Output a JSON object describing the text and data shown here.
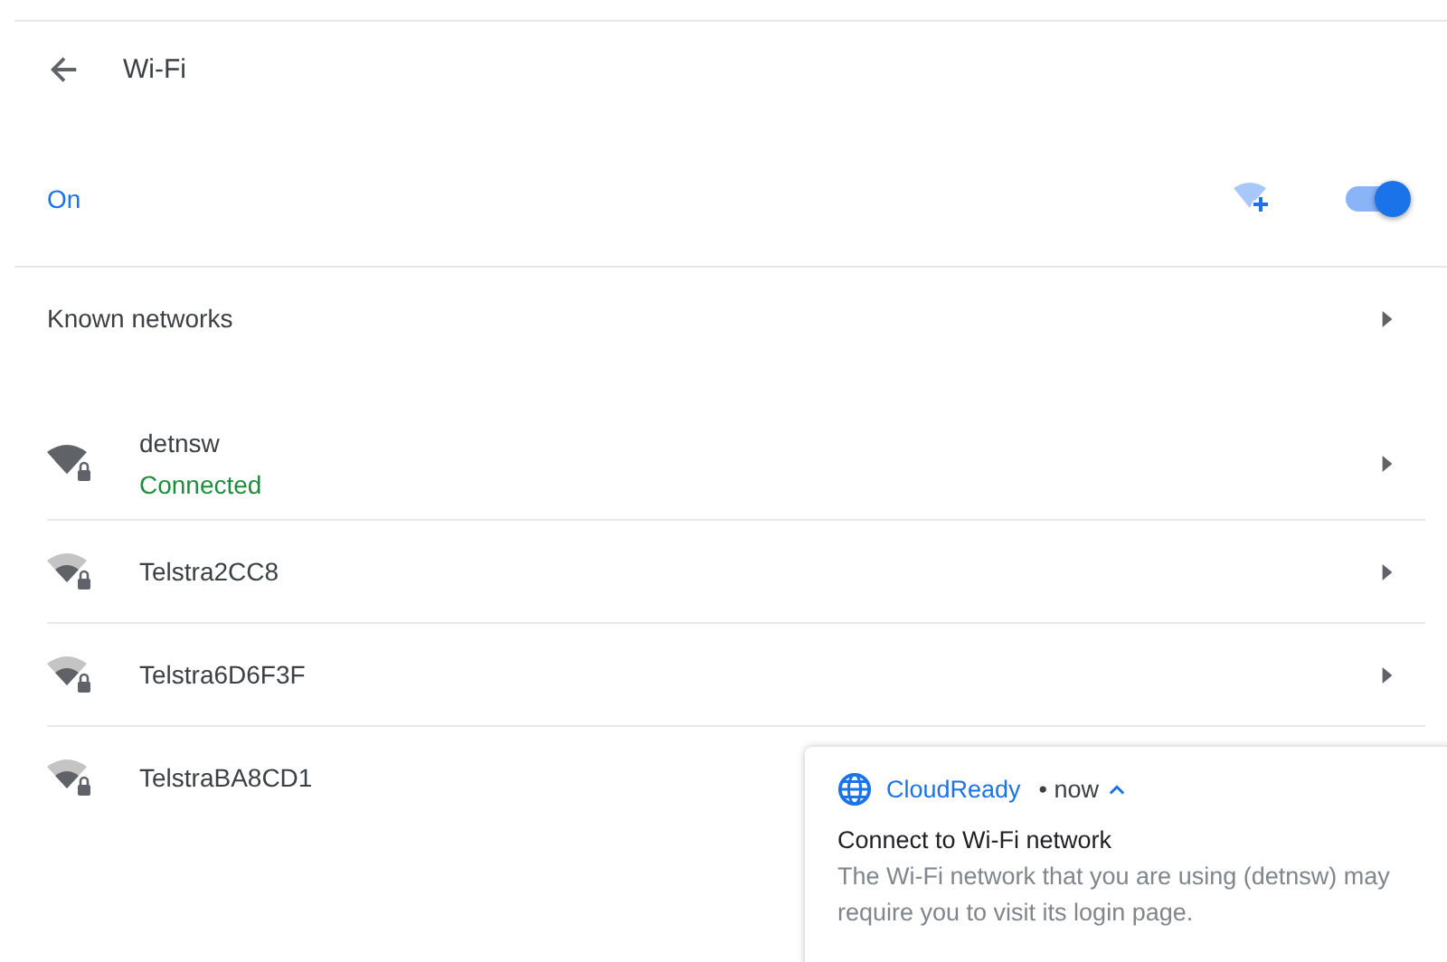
{
  "header": {
    "title": "Wi-Fi"
  },
  "wifi_toggle": {
    "label": "On",
    "on": true
  },
  "known_networks": {
    "label": "Known networks"
  },
  "networks": [
    {
      "name": "detnsw",
      "status": "Connected",
      "full_signal": true
    },
    {
      "name": "Telstra2CC8",
      "full_signal": false
    },
    {
      "name": "Telstra6D6F3F",
      "full_signal": false
    },
    {
      "name": "TelstraBA8CD1",
      "full_signal": false
    }
  ],
  "notification": {
    "app": "CloudReady",
    "time": "• now",
    "title": "Connect to Wi-Fi network",
    "body_lines": [
      "The Wi-Fi network that you are using (detnsw) may",
      "require you to visit its login page."
    ]
  }
}
